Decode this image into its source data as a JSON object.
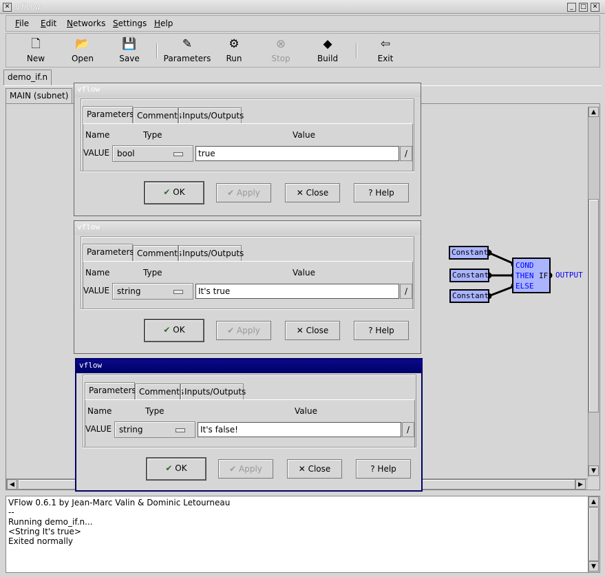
{
  "window": {
    "title": "vflow"
  },
  "menu": [
    {
      "key": "F",
      "rest": "ile"
    },
    {
      "key": "E",
      "rest": "dit"
    },
    {
      "key": "N",
      "rest": "etworks"
    },
    {
      "key": "S",
      "rest": "ettings"
    },
    {
      "key": "H",
      "rest": "elp"
    }
  ],
  "toolbar": [
    {
      "label": "New",
      "icon": "new-file-icon",
      "glyph": "🗋"
    },
    {
      "label": "Open",
      "icon": "folder-open-icon",
      "glyph": "📂"
    },
    {
      "label": "Save",
      "icon": "floppy-icon",
      "glyph": "💾"
    },
    {
      "label": "Parameters",
      "icon": "edit-params-icon",
      "glyph": "✎"
    },
    {
      "label": "Run",
      "icon": "gears-icon",
      "glyph": "⚙"
    },
    {
      "label": "Stop",
      "icon": "stop-icon",
      "glyph": "⊗",
      "disabled": true
    },
    {
      "label": "Build",
      "icon": "build-icon",
      "glyph": "◆"
    },
    {
      "label": "Exit",
      "icon": "exit-icon",
      "glyph": "⇦"
    }
  ],
  "doc_tab": "demo_if.n",
  "subnet_tab": "MAIN (subnet)",
  "dialog_common": {
    "title": "vflow",
    "tabs": [
      "Parameters",
      "Comments",
      "Inputs/Outputs"
    ],
    "col_name": "Name",
    "col_type": "Type",
    "col_value": "Value",
    "param_name": "VALUE",
    "ok": "OK",
    "apply": "Apply",
    "close": "Close",
    "help": "Help",
    "edit": "/"
  },
  "dialogs": [
    {
      "type": "bool",
      "value": "true",
      "active": false
    },
    {
      "type": "string",
      "value": "It's true",
      "active": false
    },
    {
      "type": "string",
      "value": "It's false!",
      "active": true
    }
  ],
  "network": {
    "constants": [
      "Constant",
      "Constant",
      "Constant"
    ],
    "if_node": {
      "name": "IF",
      "inputs": [
        "COND",
        "THEN",
        "ELSE"
      ],
      "output": "OUTPUT"
    },
    "node_color": "#aab4ff",
    "port_color": "#0000ff"
  },
  "log": [
    "VFlow 0.6.1 by Jean-Marc Valin & Dominic Letourneau",
    "--",
    "Running demo_if.n...",
    "<String It's true>",
    "Exited normally"
  ]
}
